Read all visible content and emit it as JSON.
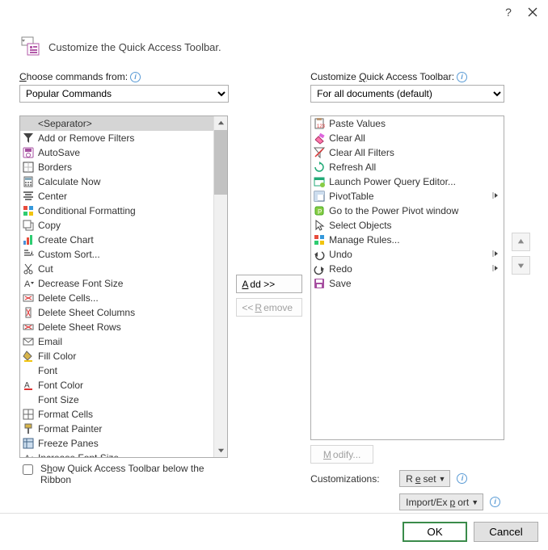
{
  "title": "Customize the Quick Access Toolbar.",
  "labels": {
    "choose": "Choose commands from:",
    "customize": "Customize Quick Access Toolbar:",
    "customizations": "Customizations:",
    "show_below": "Show Quick Access Toolbar below the Ribbon"
  },
  "combos": {
    "left": "Popular Commands",
    "right": "For all documents (default)"
  },
  "buttons": {
    "add": "Add >>",
    "remove": "<< Remove",
    "modify": "Modify...",
    "reset": "Reset",
    "import_export": "Import/Export",
    "ok": "OK",
    "cancel": "Cancel"
  },
  "left_list": [
    {
      "label": "<Separator>",
      "selected": true,
      "icon": "blank"
    },
    {
      "label": "Add or Remove Filters",
      "icon": "funnel"
    },
    {
      "label": "AutoSave",
      "icon": "autosave"
    },
    {
      "label": "Borders",
      "icon": "borders",
      "submenu": true
    },
    {
      "label": "Calculate Now",
      "icon": "calc"
    },
    {
      "label": "Center",
      "icon": "center"
    },
    {
      "label": "Conditional Formatting",
      "icon": "condfmt",
      "submenu": true
    },
    {
      "label": "Copy",
      "icon": "copy"
    },
    {
      "label": "Create Chart",
      "icon": "chart"
    },
    {
      "label": "Custom Sort...",
      "icon": "sort"
    },
    {
      "label": "Cut",
      "icon": "cut"
    },
    {
      "label": "Decrease Font Size",
      "icon": "fontdown"
    },
    {
      "label": "Delete Cells...",
      "icon": "delcells"
    },
    {
      "label": "Delete Sheet Columns",
      "icon": "delcols"
    },
    {
      "label": "Delete Sheet Rows",
      "icon": "delrows"
    },
    {
      "label": "Email",
      "icon": "email"
    },
    {
      "label": "Fill Color",
      "icon": "fillcolor",
      "submenu": true
    },
    {
      "label": "Font",
      "icon": "blank",
      "dropdown": true
    },
    {
      "label": "Font Color",
      "icon": "fontcolor",
      "submenu": true
    },
    {
      "label": "Font Size",
      "icon": "blank",
      "dropdown": true
    },
    {
      "label": "Format Cells",
      "icon": "fmtcells"
    },
    {
      "label": "Format Painter",
      "icon": "painter"
    },
    {
      "label": "Freeze Panes",
      "icon": "freeze",
      "submenu": true
    },
    {
      "label": "Increase Font Size",
      "icon": "fontup"
    }
  ],
  "right_list": [
    {
      "label": "Paste Values",
      "icon": "pastevalues"
    },
    {
      "label": "Clear All",
      "icon": "clearall"
    },
    {
      "label": "Clear All Filters",
      "icon": "clearfilter"
    },
    {
      "label": "Refresh All",
      "icon": "refresh"
    },
    {
      "label": "Launch Power Query Editor...",
      "icon": "powerquery"
    },
    {
      "label": "PivotTable",
      "icon": "pivot",
      "submenu": true
    },
    {
      "label": "Go to the Power Pivot window",
      "icon": "powerpivot"
    },
    {
      "label": "Select Objects",
      "icon": "pointer"
    },
    {
      "label": "Manage Rules...",
      "icon": "rules"
    },
    {
      "label": "Undo",
      "icon": "undo",
      "submenu": true
    },
    {
      "label": "Redo",
      "icon": "redo",
      "submenu": true
    },
    {
      "label": "Save",
      "icon": "save"
    }
  ]
}
